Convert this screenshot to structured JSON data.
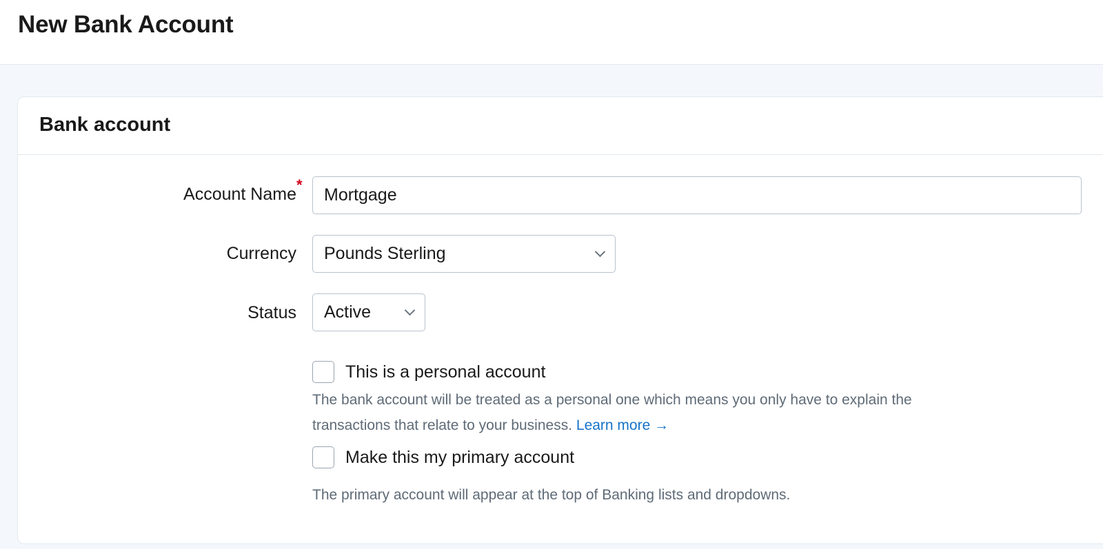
{
  "header": {
    "title": "New Bank Account"
  },
  "card": {
    "title": "Bank account"
  },
  "form": {
    "account_name": {
      "label": "Account Name",
      "required_marker": "*",
      "value": "Mortgage"
    },
    "currency": {
      "label": "Currency",
      "value": "Pounds Sterling"
    },
    "status": {
      "label": "Status",
      "value": "Active"
    },
    "personal": {
      "label": "This is a personal account",
      "checked": false,
      "help_line1": "The bank account will be treated as a personal one which means you only have to explain the",
      "help_line2": "transactions that relate to your business.",
      "learn_more": "Learn more →"
    },
    "primary": {
      "label": "Make this my primary account",
      "checked": false,
      "help": "The primary account will appear at the top of Banking lists and dropdowns."
    }
  },
  "icons": {
    "select_chevron": "chevron-down-icon"
  },
  "colors": {
    "link": "#1673c9",
    "required": "#d0021b",
    "page_bg": "#f4f8fc"
  }
}
